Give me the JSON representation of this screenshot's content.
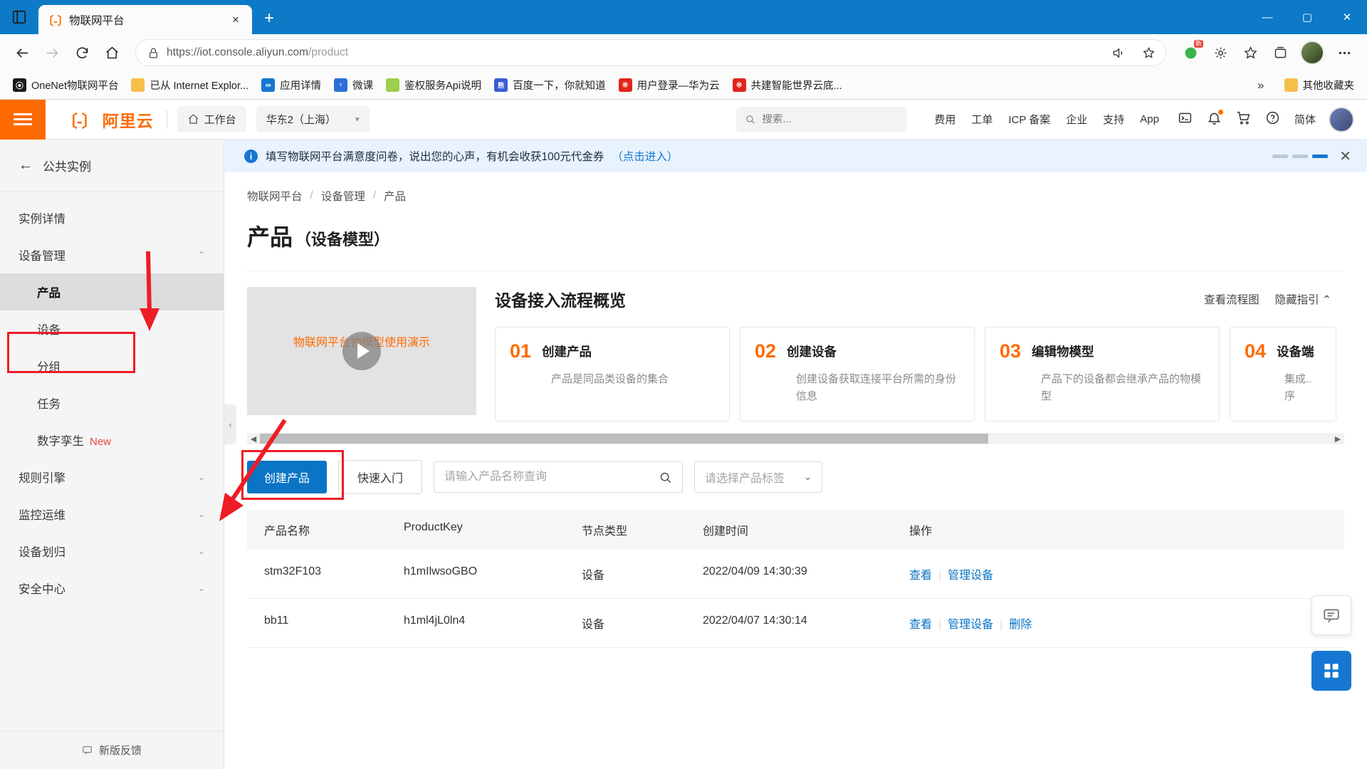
{
  "browser": {
    "tab": {
      "title": "物联网平台",
      "favicon": "aliyun-icon",
      "close_label": "×"
    },
    "newtab_label": "+",
    "window_controls": {
      "minimize": "—",
      "maximize": "▢",
      "close": "✕"
    },
    "nav": {
      "back": "back-arrow",
      "forward": "forward-arrow",
      "refresh": "refresh-icon",
      "home": "home-icon"
    },
    "omnibox": {
      "scheme": "https://",
      "host": "iot.console.aliyun.com",
      "path": "/product",
      "lock": "lock-icon",
      "read_aloud": "read-aloud-icon",
      "favorite": "star-plus-icon"
    },
    "toolbar_right": {
      "translate_badge": "新",
      "collections": "collections-icon",
      "favorites": "favorites-icon",
      "browser_essentials": "browser-essentials-icon",
      "profile": "profile-avatar",
      "settings": "more-options-icon"
    },
    "bookmarks": [
      {
        "label": "OneNet物联网平台",
        "icon_color": "#1a1a1a",
        "glyph": "⦿"
      },
      {
        "label": "已从 Internet Explor...",
        "icon_color": "#f5c04a",
        "glyph": "▭"
      },
      {
        "label": "应用详情",
        "icon_color": "#1677d2",
        "glyph": "∞"
      },
      {
        "label": "微课",
        "icon_color": "#2b6fd6",
        "glyph": "♆"
      },
      {
        "label": "鉴权服务Api说明",
        "icon_color": "#9ccf4b",
        "glyph": "◤"
      },
      {
        "label": "百度一下，你就知道",
        "icon_color": "#3b5bdb",
        "glyph": "熊"
      },
      {
        "label": "用户登录—华为云",
        "icon_color": "#e1251b",
        "glyph": "❋"
      },
      {
        "label": "共建智能世界云底...",
        "icon_color": "#e1251b",
        "glyph": "❋"
      }
    ],
    "bookmarks_overflow": "»",
    "other_favorites": {
      "label": "其他收藏夹",
      "icon_color": "#f5c04a",
      "glyph": "▭"
    }
  },
  "aliyun_header": {
    "menu_icon": "hamburger-menu-icon",
    "logo_text": "阿里云",
    "workbench": {
      "label": "工作台",
      "icon": "home-icon"
    },
    "region": {
      "label": "华东2（上海）",
      "caret": "▾"
    },
    "search_placeholder": "搜索...",
    "nav_items": [
      "费用",
      "工单",
      "ICP 备案",
      "企业",
      "支持",
      "App"
    ],
    "icons": [
      "terminal-icon",
      "bell-icon",
      "cart-icon",
      "help-icon"
    ],
    "language": "简体",
    "avatar": "user-avatar"
  },
  "sidebar": {
    "back": {
      "label": "公共实例",
      "icon": "back-arrow-icon"
    },
    "items": [
      {
        "label": "实例详情",
        "level": "top",
        "expandable": false,
        "active": false
      },
      {
        "label": "设备管理",
        "level": "top",
        "expandable": true,
        "expanded": true,
        "caret": "⌃",
        "active": false
      },
      {
        "label": "产品",
        "level": "sub",
        "active": true
      },
      {
        "label": "设备",
        "level": "sub",
        "active": false
      },
      {
        "label": "分组",
        "level": "sub",
        "active": false
      },
      {
        "label": "任务",
        "level": "sub",
        "active": false
      },
      {
        "label": "数字孪生",
        "level": "sub",
        "active": false,
        "badge": "New"
      },
      {
        "label": "规则引擎",
        "level": "top",
        "expandable": true,
        "caret": "⌄",
        "active": false
      },
      {
        "label": "监控运维",
        "level": "top",
        "expandable": true,
        "caret": "⌄",
        "active": false
      },
      {
        "label": "设备划归",
        "level": "top",
        "expandable": true,
        "caret": "⌄",
        "active": false
      },
      {
        "label": "安全中心",
        "level": "top",
        "expandable": true,
        "caret": "⌄",
        "active": false
      }
    ],
    "footer": {
      "label": "新版反馈",
      "icon": "feedback-icon"
    }
  },
  "notice": {
    "icon": "info-icon",
    "text": "填写物联网平台满意度问卷，说出您的心声，有机会收获100元代金券",
    "link": "（点击进入）",
    "close": "✕"
  },
  "breadcrumb": {
    "items": [
      "物联网平台",
      "设备管理",
      "产品"
    ],
    "separator": "/"
  },
  "page": {
    "title_main": "产品",
    "title_sub": "（设备模型）"
  },
  "guide": {
    "video": {
      "caption": "物联网平台物模型使用演示",
      "play": "play-icon"
    },
    "title": "设备接入流程概览",
    "links": [
      "查看流程图",
      "隐藏指引"
    ],
    "links_caret": "⌃",
    "steps": [
      {
        "num": "01",
        "name": "创建产品",
        "desc": "产品是同品类设备的集合"
      },
      {
        "num": "02",
        "name": "创建设备",
        "desc": "创建设备获取连接平台所需的身份信息"
      },
      {
        "num": "03",
        "name": "编辑物模型",
        "desc": "产品下的设备都会继承产品的物模型"
      },
      {
        "num": "04",
        "name": "设备端",
        "desc": "集成..序"
      }
    ]
  },
  "toolbar": {
    "create_product": "创建产品",
    "quick_start": "快速入门",
    "search_placeholder": "请输入产品名称查询",
    "search_value": "",
    "search_icon": "search-icon",
    "tag_select_placeholder": "请选择产品标签",
    "tag_caret": "⌄"
  },
  "table": {
    "columns": [
      "产品名称",
      "ProductKey",
      "节点类型",
      "创建时间",
      "操作"
    ],
    "rows": [
      {
        "name": "stm32F103",
        "product_key": "h1mIlwsoGBO",
        "node_type": "设备",
        "created": "2022/04/09 14:30:39",
        "actions": [
          "查看",
          "管理设备"
        ]
      },
      {
        "name": "bb11",
        "product_key": "h1ml4jL0ln4",
        "node_type": "设备",
        "created": "2022/04/07 14:30:14",
        "actions": [
          "查看",
          "管理设备",
          "删除"
        ]
      }
    ]
  },
  "floating": {
    "chat": "chat-icon",
    "grid": "apps-grid-icon",
    "collapse": "‹"
  },
  "scrollbar": {
    "left_arrow": "◀",
    "right_arrow": "▶"
  },
  "colors": {
    "brand_orange": "#ff6a00",
    "primary_blue": "#0b74c4",
    "link_blue": "#1677d2",
    "annotation_red": "#ee1c25",
    "browser_blue": "#0c7ac6",
    "badge_red": "#e8453c"
  }
}
